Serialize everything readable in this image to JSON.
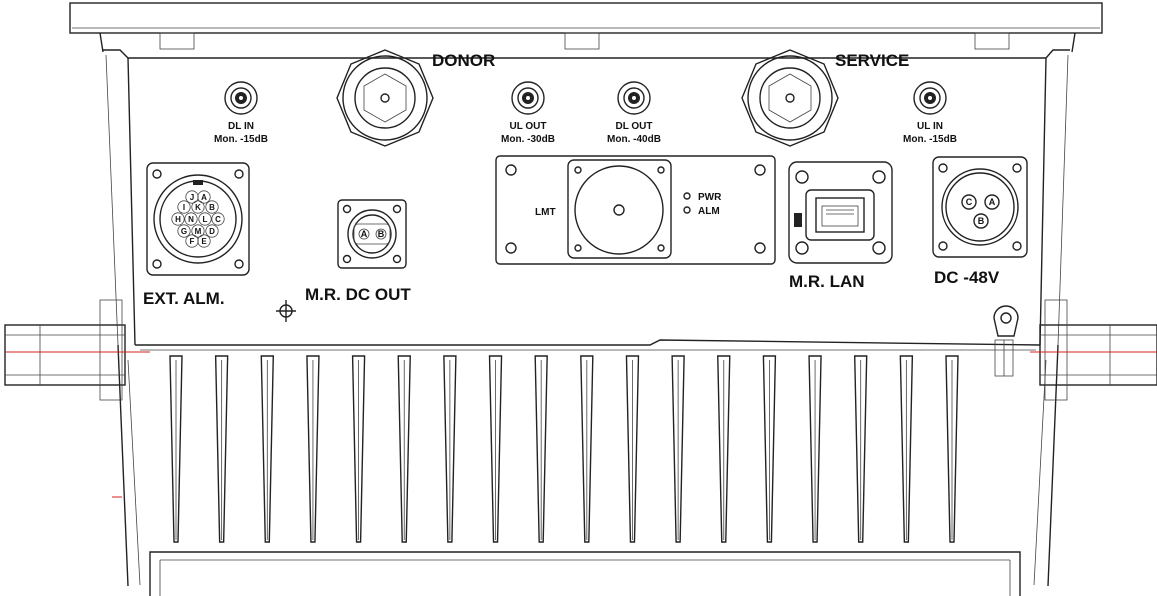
{
  "labels": {
    "donor": "DONOR",
    "service": "SERVICE",
    "dl_in": "DL IN",
    "dl_in_mon": "Mon. -15dB",
    "ul_out": "UL OUT",
    "ul_out_mon": "Mon. -30dB",
    "dl_out": "DL OUT",
    "dl_out_mon": "Mon. -40dB",
    "ul_in": "UL IN",
    "ul_in_mon": "Mon. -15dB",
    "lmt": "LMT",
    "pwr": "PWR",
    "alm": "ALM",
    "ext_alm": "EXT. ALM.",
    "mr_dc_out": "M.R. DC OUT",
    "mr_lan": "M.R. LAN",
    "dc_48v": "DC -48V"
  },
  "ext_alm_pins": [
    "J",
    "A",
    "I",
    "K",
    "B",
    "H",
    "N",
    "L",
    "C",
    "G",
    "M",
    "D",
    "F",
    "E"
  ],
  "dc_out_pins": [
    "A",
    "B"
  ],
  "dc_48v_pins": [
    "C",
    "A",
    "B"
  ],
  "heatsink_fin_count": 18,
  "colors": {
    "line": "#222222",
    "centerline": "#d42020",
    "background": "#ffffff"
  }
}
